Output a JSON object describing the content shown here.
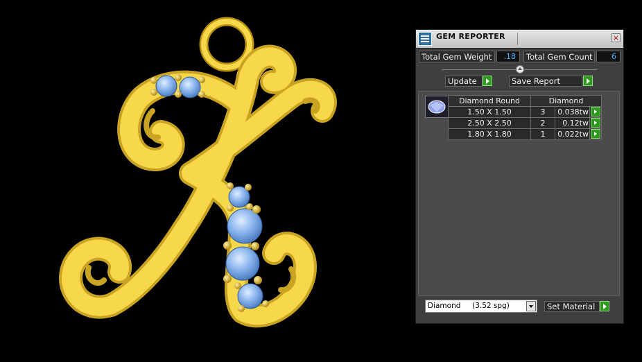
{
  "panel": {
    "title": "GEM REPORTER",
    "close_glyph": "×",
    "total_weight_label": "Total Gem Weight",
    "total_weight_value": ".18",
    "total_count_label": "Total Gem Count",
    "total_count_value": "6",
    "update_label": "Update",
    "save_report_label": "Save Report",
    "table": {
      "headers": [
        "Diamond Round",
        "Diamond"
      ],
      "rows": [
        {
          "size": "1.50 X 1.50",
          "count": "3",
          "weight": "0.038tw"
        },
        {
          "size": "2.50 X 2.50",
          "count": "2",
          "weight": "0.12tw"
        },
        {
          "size": "1.80 X 1.80",
          "count": "1",
          "weight": "0.022tw"
        }
      ]
    },
    "material_selected": "Diamond     (3.52 spg)",
    "set_material_label": "Set Material"
  },
  "icons": {
    "app": "gem-reporter-icon",
    "close": "close-icon",
    "slider": "slider-knob-icon",
    "go": "play-arrow-icon",
    "gem": "round-gem-icon",
    "dropdown": "chevron-down-icon"
  },
  "colors": {
    "gold": "#f7d84a",
    "gem_blue": "#8fb8ef",
    "go_green": "#2d9a1d",
    "value_blue": "#4fb3ff"
  }
}
